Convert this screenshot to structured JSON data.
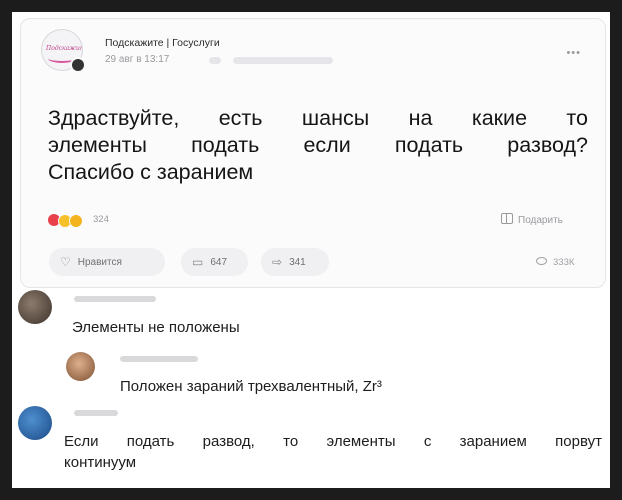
{
  "post": {
    "author": "Подскажите | Госуслуги",
    "time": "29 авг в 13:17",
    "avatar_logo_text": "Подскажите",
    "text_lines": [
      "Здраствуйте, есть шансы на какие то",
      "элементы подать если подать развод?",
      "Спасибо с заранием"
    ],
    "reaction_count": "324",
    "gift_label": "Подарить",
    "like_label": "Нравится",
    "comment_count": "647",
    "share_count": "341",
    "views": "333К"
  },
  "icons": {
    "more": "more-horizontal-icon",
    "gift": "gift-icon",
    "like": "heart-icon",
    "comment": "comment-icon",
    "share": "share-arrow-icon",
    "views": "eye-icon"
  },
  "colors": {
    "reaction_heart": "#e8414b",
    "reaction_laugh": "#f5c02a",
    "reaction_wow": "#f3b41d",
    "logo_accent": "#c0408a"
  },
  "comments": [
    {
      "lines": [
        "Элементы не положены"
      ]
    },
    {
      "lines": [
        "Положен зараний трехвалентный, Zr³"
      ]
    },
    {
      "lines": [
        "Если подать развод, то элементы с заранием порвут",
        "континуум"
      ]
    }
  ]
}
